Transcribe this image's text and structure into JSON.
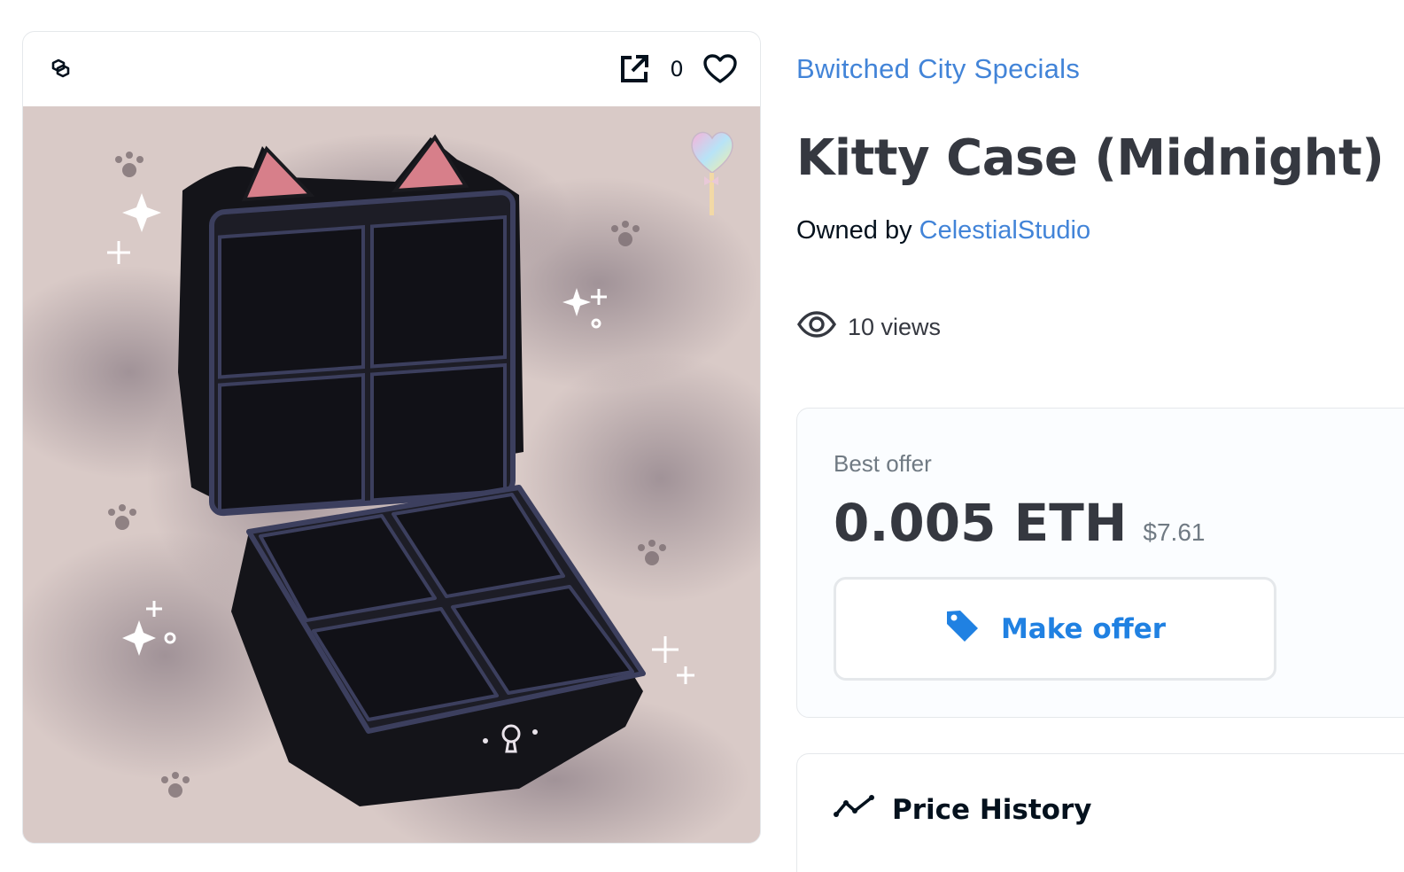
{
  "media": {
    "chain_icon": "polygon-icon",
    "external_icon": "external-link-icon",
    "favorite_count": "0",
    "favorite_icon": "heart-outline-icon",
    "image_subject": "kitty-case-midnight-art"
  },
  "item": {
    "collection": "Bwitched City Specials",
    "title": "Kitty Case (Midnight)",
    "owned_by_label": "Owned by",
    "owner": "CelestialStudio",
    "views": "10 views"
  },
  "offer": {
    "label": "Best offer",
    "price_eth": "0.005 ETH",
    "price_usd": "$7.61",
    "button_label": "Make offer",
    "button_icon": "tag-icon"
  },
  "history": {
    "title": "Price History",
    "icon": "trend-line-icon"
  },
  "colors": {
    "link": "#4284d8",
    "accent": "#2081e2",
    "text": "#353840",
    "muted": "#707a83",
    "border": "#e5e8eb"
  }
}
